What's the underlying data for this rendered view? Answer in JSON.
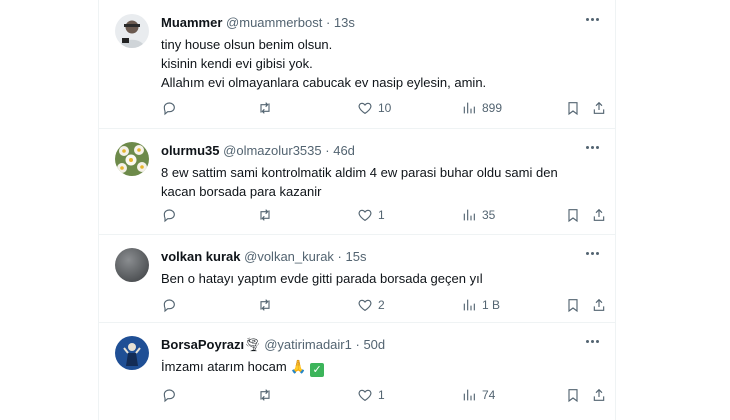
{
  "tweets": [
    {
      "name": "Muammer",
      "handle": "@muammerbost",
      "dot": "·",
      "time": "13s",
      "lines": [
        "tiny house olsun benim olsun.",
        "kisinin kendi evi gibisi yok.",
        "Allahım evi olmayanlara cabucak ev nasip eylesin, amin."
      ],
      "reply_count": "",
      "retweet_count": "",
      "like_count": "10",
      "view_count": "899",
      "avatar": "person-photo"
    },
    {
      "name": "olurmu35",
      "handle": "@olmazolur3535",
      "dot": "·",
      "time": "46d",
      "lines": [
        "8 ew sattim sami kontrolmatik aldim 4 ew parasi buhar oldu sami den",
        "kacan borsada para kazanir"
      ],
      "reply_count": "",
      "retweet_count": "",
      "like_count": "1",
      "view_count": "35",
      "avatar": "flowers-photo"
    },
    {
      "name": "volkan kurak",
      "handle": "@volkan_kurak",
      "dot": "·",
      "time": "15s",
      "lines": [
        "Ben o hatayı yaptım evde gitti parada borsada geçen yıl"
      ],
      "reply_count": "",
      "retweet_count": "",
      "like_count": "2",
      "view_count": "1 B",
      "avatar": "grey-circle"
    },
    {
      "name": "BorsaPoyrazı",
      "name_emoji": "🌪",
      "handle": "@yatirimadair1",
      "dot": "·",
      "time": "50d",
      "lines": [
        "İmzamı atarım hocam"
      ],
      "line_emojis": "🙏",
      "line_check": "✓",
      "reply_count": "",
      "retweet_count": "",
      "like_count": "1",
      "view_count": "74",
      "avatar": "blue-figure"
    }
  ],
  "icons": {
    "reply": "reply-icon",
    "retweet": "retweet-icon",
    "like": "heart-icon",
    "views": "views-icon",
    "bookmark": "bookmark-icon",
    "share": "share-icon",
    "more": "more-icon"
  },
  "colors": {
    "text": "#0f1419",
    "secondary": "#536471",
    "border": "#eff3f4",
    "check": "#3cb45a"
  }
}
